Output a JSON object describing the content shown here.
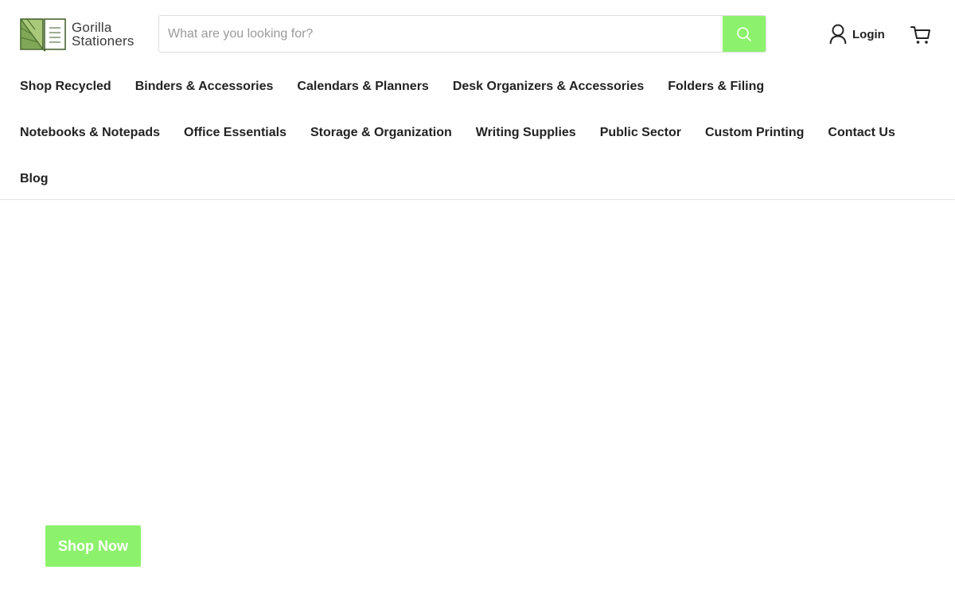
{
  "brand": {
    "name_line1": "Gorilla",
    "name_line2": "Stationers",
    "logo_icon": "leaf-notebook-logo"
  },
  "search": {
    "placeholder": "What are you looking for?",
    "value": "",
    "button_icon": "search-icon"
  },
  "account": {
    "login_label": "Login",
    "user_icon": "user-icon",
    "cart_icon": "cart-icon"
  },
  "nav": {
    "rows": [
      [
        "Shop Recycled",
        "Binders & Accessories",
        "Calendars & Planners",
        "Desk Organizers & Accessories",
        "Folders & Filing"
      ],
      [
        "Notebooks & Notepads",
        "Office Essentials",
        "Storage & Organization",
        "Writing Supplies",
        "Public Sector",
        "Custom Printing",
        "Contact Us"
      ],
      [
        "Blog"
      ]
    ]
  },
  "hero": {
    "cta_label": "Shop Now"
  },
  "colors": {
    "accent": "#8cf26b",
    "text": "#222222",
    "logo_green_dark": "#5f8a3a",
    "logo_green_light": "#a9c97a"
  }
}
